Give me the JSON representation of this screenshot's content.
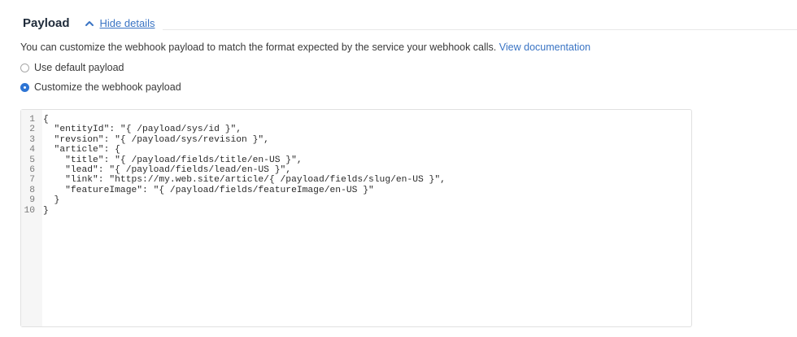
{
  "section": {
    "title": "Payload",
    "toggle_label": "Hide details"
  },
  "description": {
    "text": "You can customize the webhook payload to match the format expected by the service your webhook calls.",
    "link_text": "View documentation"
  },
  "payload_options": {
    "default_label": "Use default payload",
    "custom_label": "Customize the webhook payload",
    "selected": "custom"
  },
  "editor": {
    "lines": [
      {
        "num": "1",
        "code": "{"
      },
      {
        "num": "2",
        "code": "  \"entityId\": \"{ /payload/sys/id }\","
      },
      {
        "num": "3",
        "code": "  \"revsion\": \"{ /payload/sys/revision }\","
      },
      {
        "num": "4",
        "code": "  \"article\": {"
      },
      {
        "num": "5",
        "code": "    \"title\": \"{ /payload/fields/title/en-US }\","
      },
      {
        "num": "6",
        "code": "    \"lead\": \"{ /payload/fields/lead/en-US }\","
      },
      {
        "num": "7",
        "code": "    \"link\": \"https://my.web.site/article/{ /payload/fields/slug/en-US }\","
      },
      {
        "num": "8",
        "code": "    \"featureImage\": \"{ /payload/fields/featureImage/en-US }\""
      },
      {
        "num": "9",
        "code": "  }"
      },
      {
        "num": "10",
        "code": "}"
      }
    ]
  },
  "colors": {
    "accent": "#2e75d4",
    "link": "#3a74c4",
    "gutter_bg": "#f6f6f6",
    "border": "#e1e1e1"
  },
  "icons": {
    "toggle": "chevron-up-icon"
  }
}
